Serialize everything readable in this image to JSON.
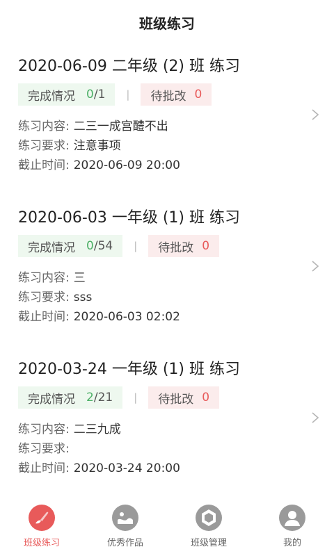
{
  "header": {
    "title": "班级练习"
  },
  "labels": {
    "completion": "完成情况",
    "pending": "待批改",
    "separator": "|",
    "content": "练习内容:",
    "requirement": "练习要求:",
    "deadline": "截止时间:"
  },
  "cards": [
    {
      "title": "2020-06-09 二年级 (2) 班 练习",
      "done": "0",
      "total": "1",
      "pending": "0",
      "content": "二三一成宫醴不出",
      "requirement": "注意事项",
      "deadline": "2020-06-09 20:00"
    },
    {
      "title": "2020-06-03 一年级 (1) 班 练习",
      "done": "0",
      "total": "54",
      "pending": "0",
      "content": "三",
      "requirement": "sss",
      "deadline": "2020-06-03 02:02"
    },
    {
      "title": "2020-03-24 一年级 (1) 班 练习",
      "done": "2",
      "total": "21",
      "pending": "0",
      "content": "二三九成",
      "requirement": "",
      "deadline": "2020-03-24 20:00"
    }
  ],
  "tabs": [
    {
      "label": "班级练习",
      "icon": "brush-icon",
      "active": true
    },
    {
      "label": "优秀作品",
      "icon": "artwork-icon",
      "active": false
    },
    {
      "label": "班级管理",
      "icon": "class-management-icon",
      "active": false
    },
    {
      "label": "我的",
      "icon": "user-profile-icon",
      "active": false
    }
  ],
  "colors": {
    "accent": "#e85a5a",
    "done": "#4caf66",
    "tab_inactive": "#9a9a9a"
  }
}
